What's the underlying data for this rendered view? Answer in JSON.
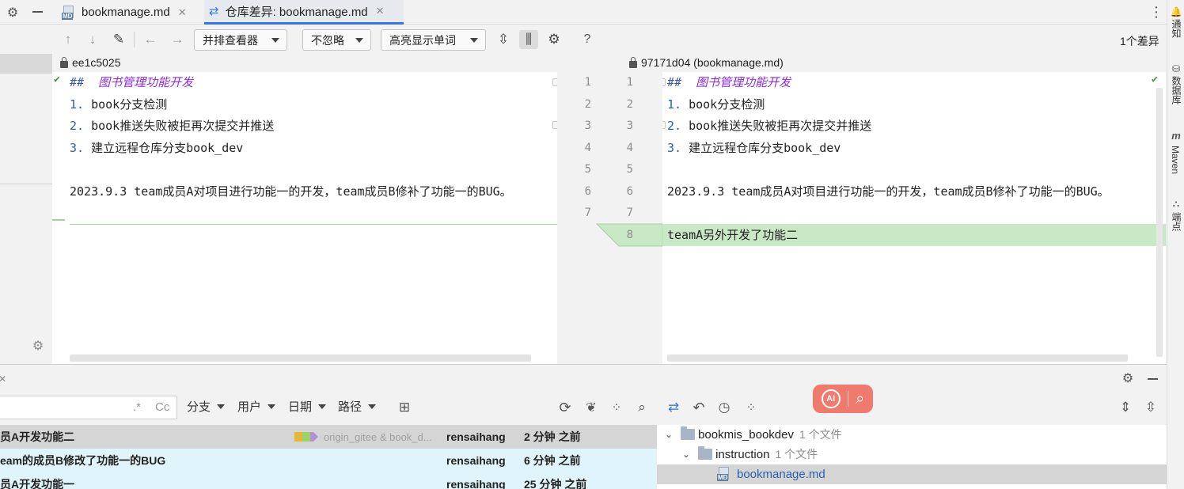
{
  "tabs": [
    {
      "label": "bookmanage.md",
      "active": false
    },
    {
      "label": "仓库差异: bookmanage.md",
      "active": true
    }
  ],
  "toolbar": {
    "viewer": "并排查看器",
    "ignore": "不忽略",
    "highlight": "高亮显示单词",
    "help": "?",
    "diff_count": "1个差异"
  },
  "left_revision": "ee1c5025",
  "right_revision": "97171d04 (bookmanage.md)",
  "left_lines": {
    "l1_mark": "##",
    "l1_text": "图书管理功能开发",
    "l2_num": "1.",
    "l2_text": "book分支检测",
    "l3_num": "2.",
    "l3_text": "book推送失败被拒再次提交并推送",
    "l4_num": "3.",
    "l4_text": "建立远程仓库分支book_dev",
    "l6_text": "2023.9.3 team成员A对项目进行功能一的开发，team成员B修补了功能一的BUG。"
  },
  "right_lines": {
    "l1_mark": "##",
    "l1_text": "图书管理功能开发",
    "l2_num": "1.",
    "l2_text": "book分支检测",
    "l3_num": "2.",
    "l3_text": "book推送失败被拒再次提交并推送",
    "l4_num": "3.",
    "l4_text": "建立远程仓库分支book_dev",
    "l6_text": "2023.9.3 team成员A对项目进行功能一的开发，team成员B修补了功能一的BUG。",
    "l8_text": "teamA另外开发了功能二"
  },
  "gutter": {
    "left_numbers": [
      "1",
      "2",
      "3",
      "4",
      "5",
      "6",
      "7"
    ],
    "right_numbers": [
      "1",
      "2",
      "3",
      "4",
      "5",
      "6",
      "7",
      "8"
    ]
  },
  "right_tools": {
    "notifications": "通知",
    "database": "数据库",
    "maven": "Maven",
    "endpoints": "端点"
  },
  "log": {
    "filters": {
      "regex": ".*",
      "case": "Cc",
      "branch": "分支",
      "user": "用户",
      "date": "日期",
      "path": "路径"
    },
    "rows": [
      {
        "message": "员A开发功能二",
        "refs": "origin_gitee & book_d...",
        "author": "rensaihang",
        "time": "2 分钟 之前"
      },
      {
        "message": "eam的成员B修改了功能一的BUG",
        "refs": "",
        "author": "rensaihang",
        "time": "6 分钟 之前"
      },
      {
        "message": "员A开发功能一",
        "refs": "",
        "author": "rensaihang",
        "time": "25 分钟 之前"
      }
    ]
  },
  "tree": {
    "root_label": "bookmis_bookdev",
    "root_count": "1 个文件",
    "folder_label": "instruction",
    "folder_count": "1 个文件",
    "file_label": "bookmanage.md"
  },
  "overlay_label": "AI",
  "colors": {
    "added_line": "#c9e8c5",
    "selected_row": "#d5d5d5",
    "highlight_row": "#dff5fb",
    "link_blue": "#2a5fb0",
    "overlay": "#f07a6e"
  }
}
